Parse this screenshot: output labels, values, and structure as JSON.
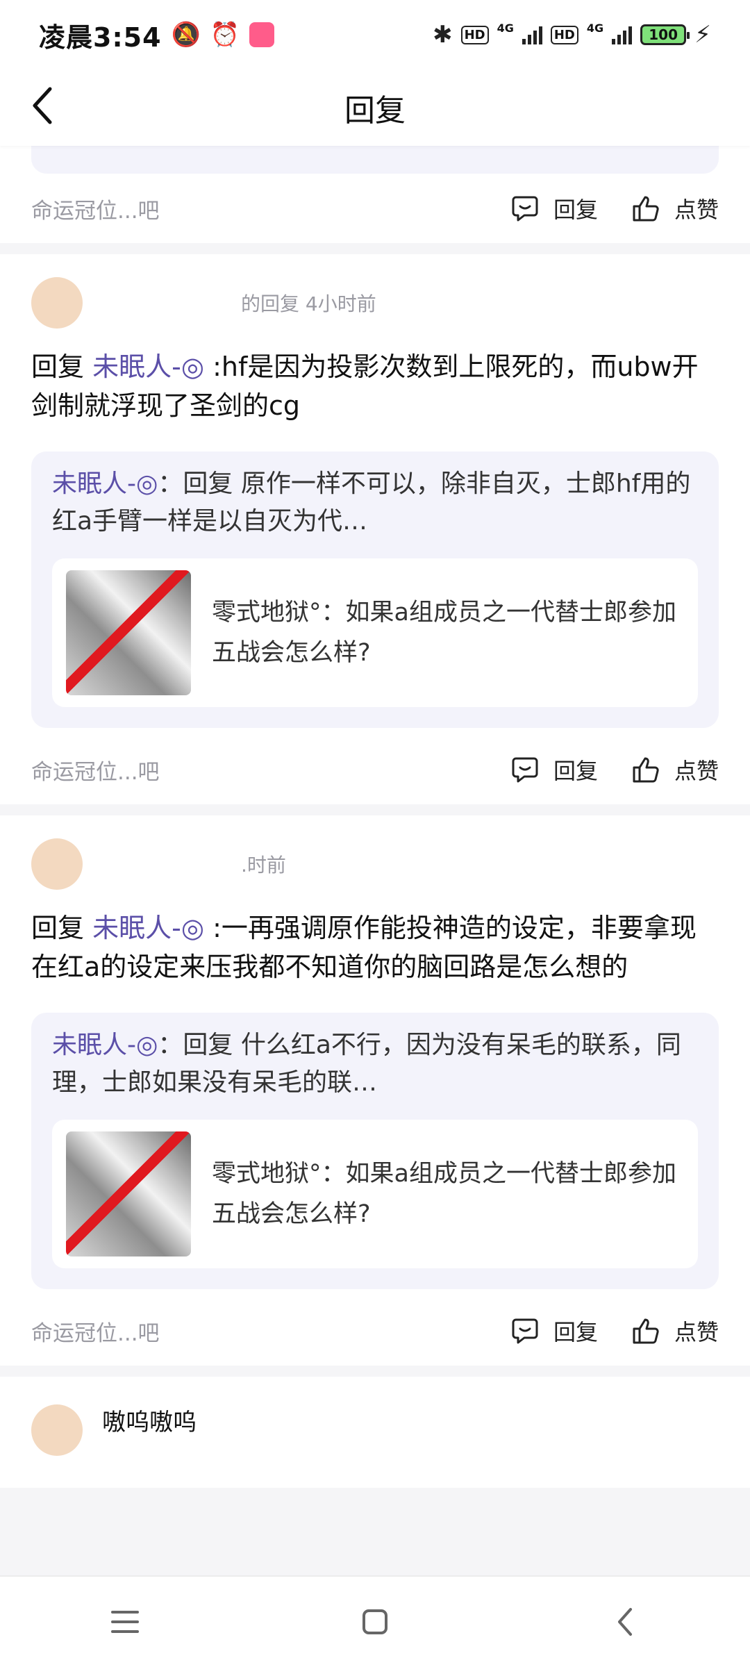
{
  "status_bar": {
    "time": "凌晨3:54",
    "battery": "100",
    "hd1": "HD",
    "hd2": "HD",
    "net1": "4G",
    "net2": "4G"
  },
  "header": {
    "title": "回复"
  },
  "cards": [
    {
      "forum": "命运冠位...吧",
      "reply_label": "回复",
      "like_label": "点赞"
    },
    {
      "meta": "的回复  4小时前",
      "reply_prefix": "回复",
      "mention": "未眠人-◎",
      "reply_body": ":hf是因为投影次数到上限死的，而ubw开剑制就浮现了圣剑的cg",
      "quote_author": "未眠人-◎",
      "quote_body": "：回复                    原作一样不可以，除非自灭，士郎hf用的红a手臂一样是以自灭为代…",
      "thread_title": "零式地狱°：如果a组成员之一代替士郎参加五战会怎么样?",
      "forum": "命运冠位...吧",
      "reply_label": "回复",
      "like_label": "点赞"
    },
    {
      "meta": ".时前",
      "reply_prefix": "回复",
      "mention": "未眠人-◎",
      "reply_body": ":一再强调原作能投神造的设定，非要拿现在红a的设定来压我都不知道你的脑回路是怎么想的",
      "quote_author": "未眠人-◎",
      "quote_body": "：回复                    什么红a不行，因为没有呆毛的联系，同理，士郎如果没有呆毛的联…",
      "thread_title": "零式地狱°：如果a组成员之一代替士郎参加五战会怎么样?",
      "forum": "命运冠位...吧",
      "reply_label": "回复",
      "like_label": "点赞"
    }
  ],
  "next_card": {
    "name": "嗷呜嗷呜"
  },
  "icons": {
    "back": "back-arrow-icon",
    "reply": "comment-icon",
    "like": "thumbs-up-icon",
    "menu": "menu-icon",
    "home": "home-icon",
    "back_nav": "back-icon"
  }
}
